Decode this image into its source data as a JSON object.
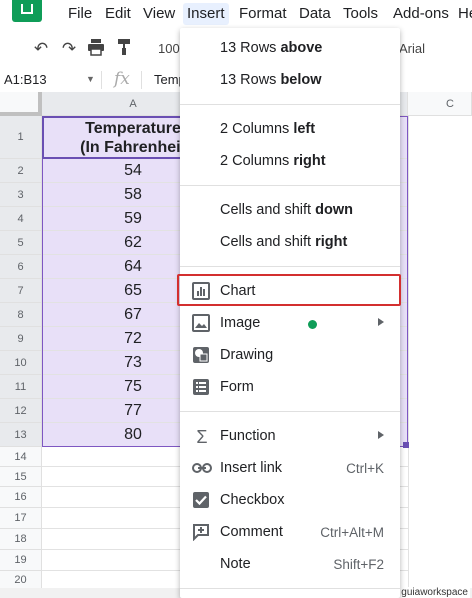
{
  "menubar": {
    "items": [
      {
        "label": "File"
      },
      {
        "label": "Edit"
      },
      {
        "label": "View"
      },
      {
        "label": "Insert"
      },
      {
        "label": "Format"
      },
      {
        "label": "Data"
      },
      {
        "label": "Tools"
      },
      {
        "label": "Add-ons"
      },
      {
        "label": "He"
      }
    ],
    "active": "Insert"
  },
  "toolbar": {
    "zoom": "100",
    "font": "Arial"
  },
  "formula_bar": {
    "name_box": "A1:B13",
    "fx": "fx",
    "content": "Temp"
  },
  "grid": {
    "columns": [
      {
        "label": "A"
      },
      {
        "label": "C"
      }
    ],
    "rows": [
      {
        "num": "1",
        "value_line1": "Temperature",
        "value_line2": "(In Fahrenheit"
      },
      {
        "num": "2",
        "value": "54"
      },
      {
        "num": "3",
        "value": "58"
      },
      {
        "num": "4",
        "value": "59"
      },
      {
        "num": "5",
        "value": "62"
      },
      {
        "num": "6",
        "value": "64"
      },
      {
        "num": "7",
        "value": "65"
      },
      {
        "num": "8",
        "value": "67"
      },
      {
        "num": "9",
        "value": "72"
      },
      {
        "num": "10",
        "value": "73"
      },
      {
        "num": "11",
        "value": "75"
      },
      {
        "num": "12",
        "value": "77"
      },
      {
        "num": "13",
        "value": "80"
      },
      {
        "num": "14",
        "value": ""
      },
      {
        "num": "15",
        "value": ""
      },
      {
        "num": "16",
        "value": ""
      },
      {
        "num": "17",
        "value": ""
      },
      {
        "num": "18",
        "value": ""
      },
      {
        "num": "19",
        "value": ""
      },
      {
        "num": "20",
        "value": ""
      }
    ]
  },
  "insert_menu": {
    "rows_above_pre": "13 Rows ",
    "rows_above_bold": "above",
    "rows_below_pre": "13 Rows ",
    "rows_below_bold": "below",
    "cols_left_pre": "2 Columns ",
    "cols_left_bold": "left",
    "cols_right_pre": "2 Columns ",
    "cols_right_bold": "right",
    "shift_down_pre": "Cells and shift ",
    "shift_down_bold": "down",
    "shift_right_pre": "Cells and shift ",
    "shift_right_bold": "right",
    "chart": "Chart",
    "image": "Image",
    "drawing": "Drawing",
    "form": "Form",
    "function": "Function",
    "insert_link": "Insert link",
    "insert_link_shortcut": "Ctrl+K",
    "checkbox": "Checkbox",
    "comment": "Comment",
    "comment_shortcut": "Ctrl+Alt+M",
    "note": "Note",
    "note_shortcut": "Shift+F2",
    "highlight_color": "#d32f2f"
  },
  "watermark": "guiaworkspace"
}
